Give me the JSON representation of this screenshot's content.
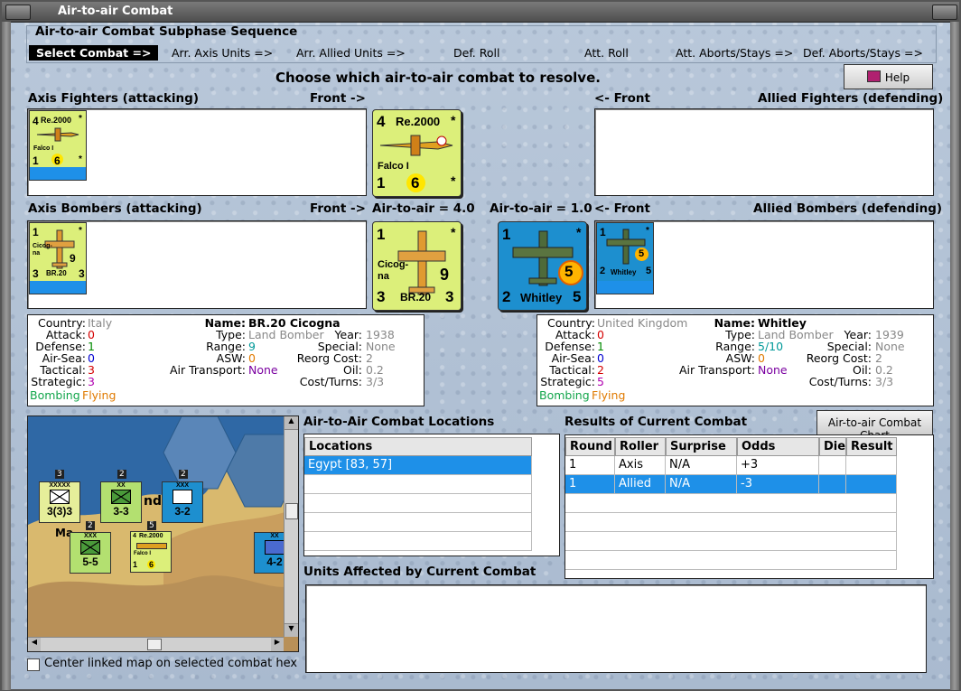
{
  "window": {
    "title": "Air-to-air Combat"
  },
  "sequence": {
    "heading": "Air-to-air Combat Subphase Sequence",
    "steps": [
      "Select Combat =>",
      "Arr. Axis Units =>",
      "Arr. Allied Units =>",
      "Def. Roll",
      "Att. Roll",
      "Att. Aborts/Stays =>",
      "Def. Aborts/Stays =>"
    ]
  },
  "prompt": "Choose which air-to-air combat to resolve.",
  "help_button": "Help",
  "sections": {
    "axis_fighters": "Axis Fighters (attacking)",
    "front_right_1": "Front ->",
    "front_left_1": "<- Front",
    "allied_fighters": "Allied Fighters (defending)",
    "axis_bombers": "Axis Bombers (attacking)",
    "front_right_2": "Front ->",
    "air_to_air_axis": "Air-to-air = 4.0",
    "air_to_air_allied": "Air-to-air = 1.0",
    "front_left_2": "<- Front",
    "allied_bombers": "Allied Bombers (defending)"
  },
  "counters": {
    "re2000": {
      "top_left": "4",
      "name": "Re.2000",
      "star": "*",
      "sub": "Falco I",
      "bottom_left": "1",
      "range": "6"
    },
    "br20": {
      "top_left": "1",
      "name": "Cicog-\nna",
      "model": "BR.20",
      "star": "*",
      "val": "9",
      "bottom_left": "3",
      "bottom_right": "3"
    },
    "whitley": {
      "top_left": "1",
      "star": "*",
      "val": "5",
      "bottom_left": "2",
      "name": "Whitley",
      "bottom_right": "5"
    }
  },
  "axis_info": {
    "country_label": "Country:",
    "country": "Italy",
    "attack_label": "Attack:",
    "attack": "0",
    "defense_label": "Defense:",
    "defense": "1",
    "airsea_label": "Air-Sea:",
    "airsea": "0",
    "tactical_label": "Tactical:",
    "tactical": "3",
    "strategic_label": "Strategic:",
    "strategic": "3",
    "flag1": "Bombing",
    "flag2": "Flying",
    "name_label": "Name:",
    "name": "BR.20 Cicogna",
    "type_label": "Type:",
    "type": "Land Bomber",
    "year_label": "Year:",
    "year": "1938",
    "range_label": "Range:",
    "range": "9",
    "special_label": "Special:",
    "special": "None",
    "asw_label": "ASW:",
    "asw": "0",
    "reorg_label": "Reorg Cost:",
    "reorg": "2",
    "airtrans_label": "Air Transport:",
    "airtrans": "None",
    "oil_label": "Oil:",
    "oil": "0.2",
    "cost_label": "Cost/Turns:",
    "cost": "3/3"
  },
  "allied_info": {
    "country_label": "Country:",
    "country": "United Kingdom",
    "attack_label": "Attack:",
    "attack": "0",
    "defense_label": "Defense:",
    "defense": "1",
    "airsea_label": "Air-Sea:",
    "airsea": "0",
    "tactical_label": "Tactical:",
    "tactical": "2",
    "strategic_label": "Strategic:",
    "strategic": "5",
    "flag1": "Bombing",
    "flag2": "Flying",
    "name_label": "Name:",
    "name": "Whitley",
    "type_label": "Type:",
    "type": "Land Bomber",
    "year_label": "Year:",
    "year": "1939",
    "range_label": "Range:",
    "range": "5/10",
    "special_label": "Special:",
    "special": "None",
    "asw_label": "ASW:",
    "asw": "0",
    "reorg_label": "Reorg Cost:",
    "reorg": "2",
    "airtrans_label": "Air Transport:",
    "airtrans": "None",
    "oil_label": "Oil:",
    "oil": "0.2",
    "cost_label": "Cost/Turns:",
    "cost": "3/3"
  },
  "locations": {
    "heading": "Air-to-Air Combat Locations",
    "column": "Locations",
    "rows": [
      "Egypt [83, 57]"
    ]
  },
  "results": {
    "heading": "Results of Current Combat",
    "chart_button": "Air-to-air Combat Chart",
    "columns": [
      "Round",
      "Roller",
      "Surprise",
      "Odds",
      "Die",
      "Result"
    ],
    "rows": [
      [
        "1",
        "Axis",
        "N/A",
        "+3",
        "",
        ""
      ],
      [
        "1",
        "Allied",
        "N/A",
        "-3",
        "",
        ""
      ]
    ]
  },
  "affected_heading": "Units Affected by Current Combat",
  "center_checkbox": "Center linked map on selected combat hex",
  "map": {
    "stacks": [
      "3",
      "2",
      "2",
      "2",
      "5"
    ],
    "units": [
      {
        "size": "XXXXX",
        "str": "3(3)3"
      },
      {
        "size": "XX",
        "str": "3-3"
      },
      {
        "size": "XXX",
        "str": "3-2"
      },
      {
        "size": "XXX",
        "str": "5-5"
      },
      {
        "size": "XX",
        "str": "4-2"
      }
    ],
    "mini_counter": {
      "top": "4",
      "name": "Re.2000",
      "sub": "Falco I",
      "a": "1",
      "b": "6"
    },
    "fragments": [
      "nd",
      "Ma"
    ]
  }
}
